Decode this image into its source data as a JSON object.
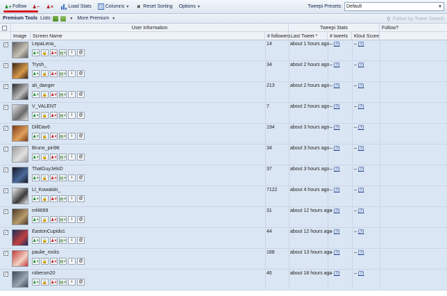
{
  "toolbar": {
    "follow_label": "Follow",
    "unfollow_label": "",
    "block_label": "",
    "load_stats_label": "Load Stats",
    "columns_label": "Columns",
    "reset_sorting_label": "Reset Sorting",
    "options_label": "Options",
    "presets_label": "Tweepi Presets:",
    "presets_value": "Default"
  },
  "premium": {
    "tools_label": "Premium Tools",
    "lists_label": "Lists:",
    "more_label": "More Premium",
    "search_placeholder": "Follow by Tweet Search"
  },
  "grid": {
    "group_user_info": "User Information",
    "group_tweepi_stats": "Tweepi Stats",
    "follow_header": "Follow?",
    "col_image": "Image",
    "col_screen_name": "Screen Name",
    "col_followers": "# followers",
    "col_last_tweet": "Last Tweet *",
    "col_tweets": "# tweets",
    "col_klout": "Klout Score"
  },
  "rows": [
    {
      "name": "LepaLena_",
      "followers": "14",
      "last_tweet": "about 1 hours ago",
      "tweets": "(?)",
      "klout": "(?)",
      "av": [
        "#5a5a5a",
        "#c9c2b4"
      ]
    },
    {
      "name": "Trysh_",
      "followers": "34",
      "last_tweet": "about 2 hours ago",
      "tweets": "(?)",
      "klout": "(?)",
      "av": [
        "#3a2516",
        "#d99a4a"
      ]
    },
    {
      "name": "ali_danger",
      "followers": "213",
      "last_tweet": "about 2 hours ago",
      "tweets": "(?)",
      "klout": "(?)",
      "av": [
        "#2a2a2a",
        "#bcbcbc"
      ]
    },
    {
      "name": "V_VALENT",
      "followers": "7",
      "last_tweet": "about 2 hours ago",
      "tweets": "(?)",
      "klout": "(?)",
      "av": [
        "#e8e8e8",
        "#6a6a6a"
      ]
    },
    {
      "name": "DillDav6",
      "followers": "194",
      "last_tweet": "about 3 hours ago",
      "tweets": "(?)",
      "klout": "(?)",
      "av": [
        "#7a3b1a",
        "#e2a15a"
      ]
    },
    {
      "name": "Bruno_piri96",
      "followers": "34",
      "last_tweet": "about 3 hours ago",
      "tweets": "(?)",
      "klout": "(?)",
      "av": [
        "#9a9a9a",
        "#e0e0e0"
      ]
    },
    {
      "name": "ThatGuyJeloD",
      "followers": "37",
      "last_tweet": "about 3 hours ago",
      "tweets": "(?)",
      "klout": "(?)",
      "av": [
        "#1a1a2a",
        "#4a6a9a"
      ]
    },
    {
      "name": "Lt_Kowalski_",
      "followers": "7122",
      "last_tweet": "about 4 hours ago",
      "tweets": "(?)",
      "klout": "(?)",
      "av": [
        "#f0f0f0",
        "#3a3a3a"
      ]
    },
    {
      "name": "mf4699",
      "followers": "31",
      "last_tweet": "about 12 hours ago",
      "tweets": "(?)",
      "klout": "(?)",
      "av": [
        "#4a3a2a",
        "#b89a6a"
      ]
    },
    {
      "name": "EastonCupido1",
      "followers": "44",
      "last_tweet": "about 12 hours ago",
      "tweets": "(?)",
      "klout": "(?)",
      "av": [
        "#1a2a5a",
        "#c04040"
      ]
    },
    {
      "name": "paulie_rocks",
      "followers": "188",
      "last_tweet": "about 13 hours ago",
      "tweets": "(?)",
      "klout": "(?)",
      "av": [
        "#c23a3a",
        "#f2d2c2"
      ]
    },
    {
      "name": "robersm20",
      "followers": "46",
      "last_tweet": "about 18 hours ago",
      "tweets": "(?)",
      "klout": "(?)",
      "av": [
        "#3a4a5a",
        "#9aa6b0"
      ]
    }
  ],
  "colors": {
    "row_bg": "#dbe6f4",
    "toolbar_bg": "#e4ebf4",
    "highlight_underline": "#d7161b"
  }
}
